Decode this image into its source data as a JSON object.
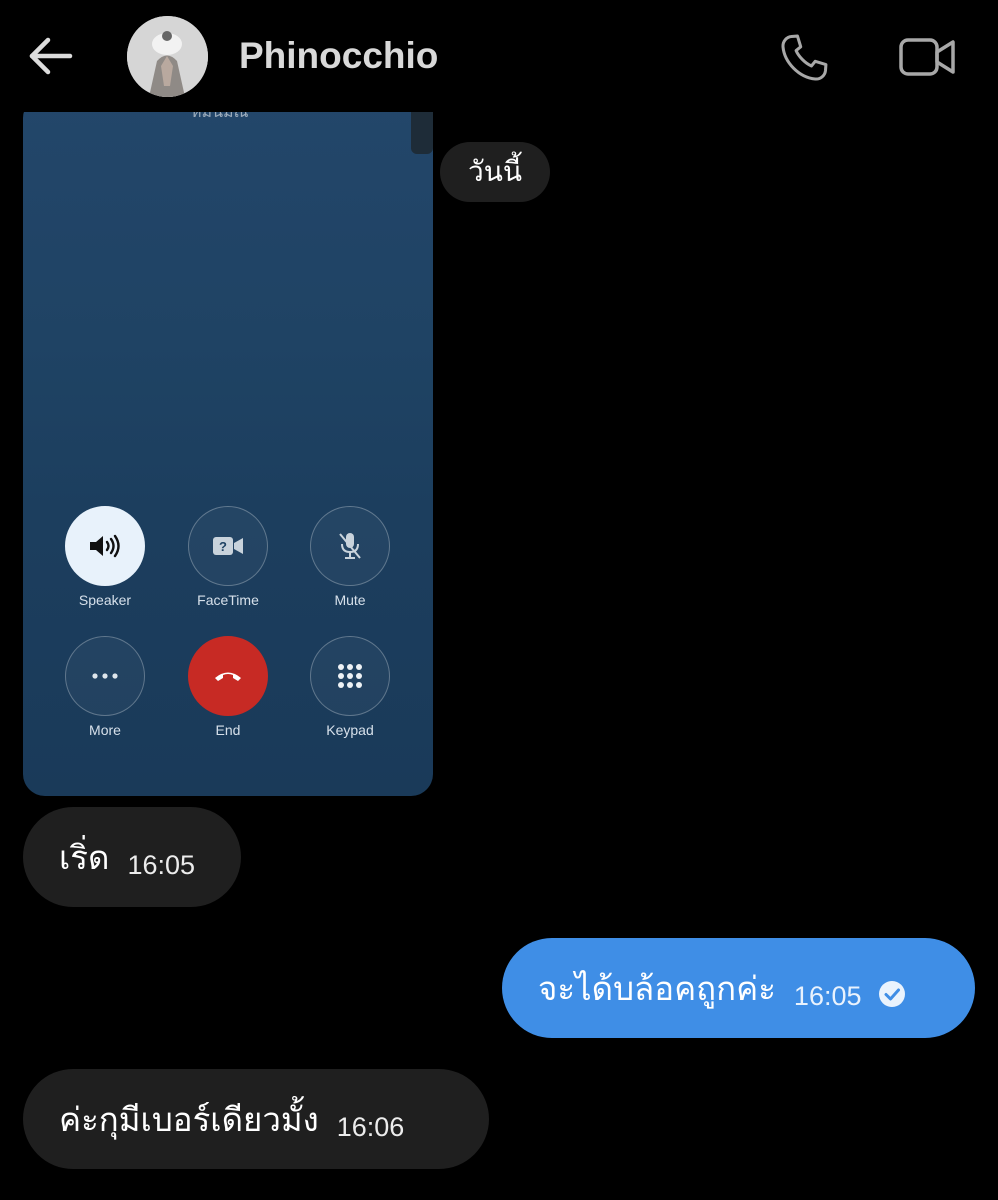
{
  "header": {
    "contact_name": "Phinocchio",
    "back_icon": "arrow-left-icon",
    "call_icon": "phone-icon",
    "video_icon": "video-camera-icon"
  },
  "shared_image": {
    "caller_name_cut": "หมั่นมณี",
    "buttons": [
      {
        "label": "Speaker",
        "icon": "speaker-icon"
      },
      {
        "label": "FaceTime",
        "icon": "facetime-icon"
      },
      {
        "label": "Mute",
        "icon": "mic-off-icon"
      },
      {
        "label": "More",
        "icon": "more-icon"
      },
      {
        "label": "End",
        "icon": "end-call-icon",
        "color": "#c72a24"
      },
      {
        "label": "Keypad",
        "icon": "keypad-icon"
      }
    ]
  },
  "date_separator": "วันนี้",
  "messages": [
    {
      "direction": "incoming",
      "text": "เริ่ด",
      "time": "16:05"
    },
    {
      "direction": "outgoing",
      "text": "จะได้บล้อคถูกค่ะ",
      "time": "16:05",
      "status_icon": "read-check-icon"
    },
    {
      "direction": "incoming",
      "text": "ค่ะกุมีเบอร์เดียวมั้ง",
      "time": "16:06"
    }
  ],
  "colors": {
    "background": "#000000",
    "incoming_bubble": "#1f1f1f",
    "outgoing_bubble": "#3f8ee6",
    "end_call": "#c72a24"
  }
}
